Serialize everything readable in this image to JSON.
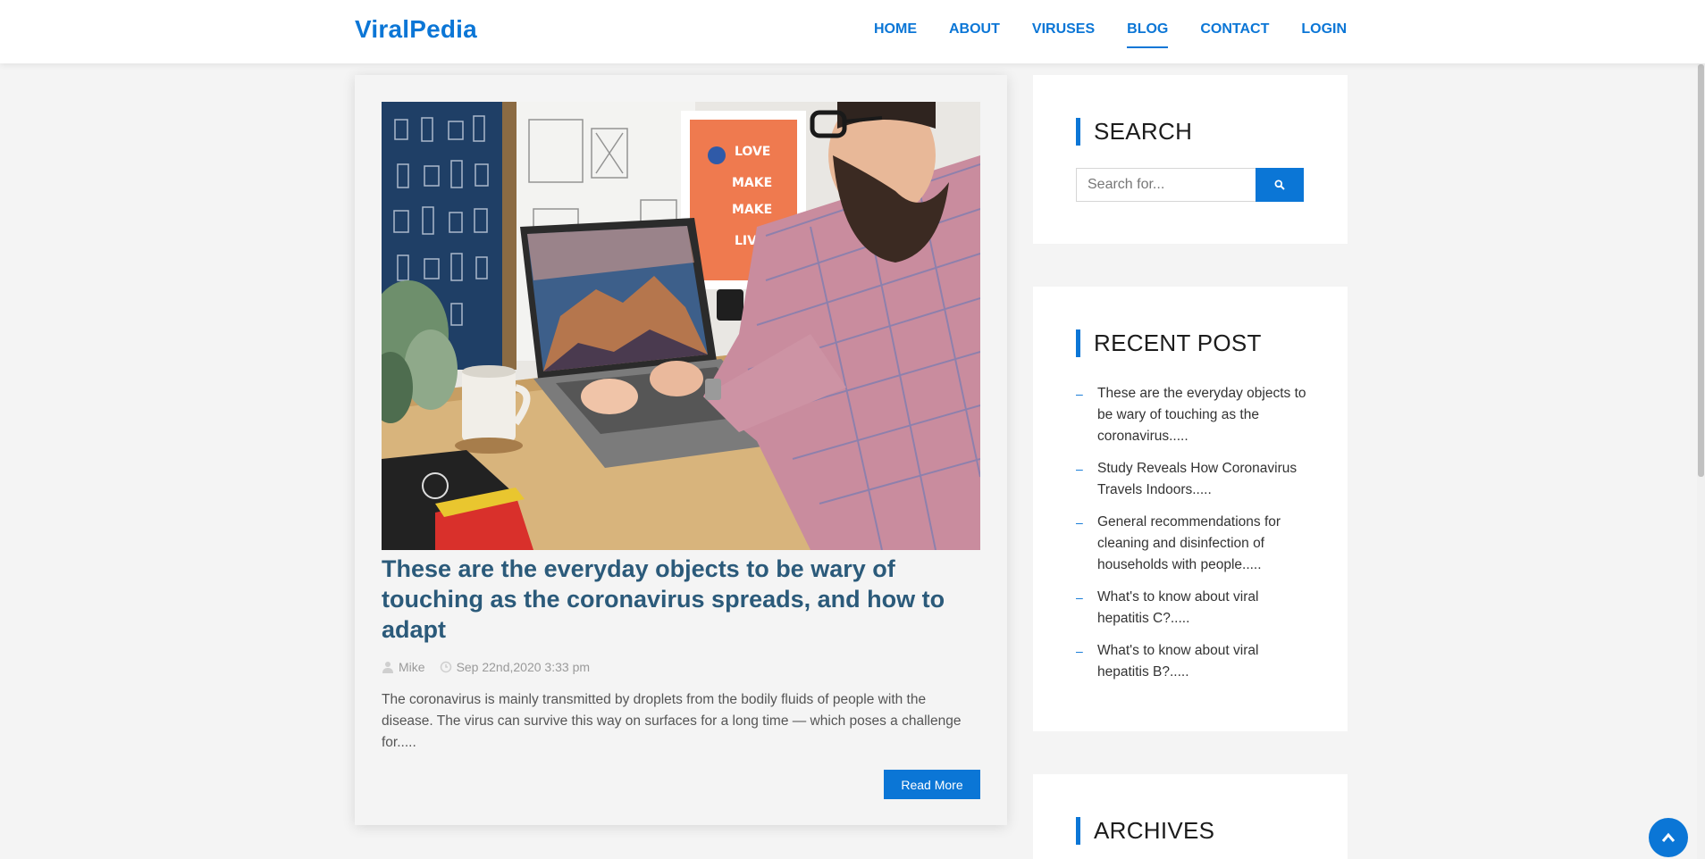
{
  "header": {
    "brand": "ViralPedia",
    "nav": [
      {
        "label": "HOME"
      },
      {
        "label": "ABOUT"
      },
      {
        "label": "VIRUSES"
      },
      {
        "label": "BLOG",
        "active": true
      },
      {
        "label": "CONTACT"
      },
      {
        "label": "LOGIN"
      }
    ]
  },
  "post": {
    "title": "These are the everyday objects to be wary of touching as the coronavirus spreads, and how to adapt",
    "author": "Mike",
    "date": "Sep 22nd,2020 3:33 pm",
    "excerpt": "The coronavirus is mainly transmitted by droplets from the bodily fluids of people with the disease. The virus can survive this way on surfaces for a long time — which poses a challenge for.....",
    "read_more": "Read More"
  },
  "sidebar": {
    "search": {
      "title": "SEARCH",
      "placeholder": "Search for..."
    },
    "recent": {
      "title": "RECENT POST",
      "items": [
        "These are the everyday objects to be wary of touching as the coronavirus.....",
        "Study Reveals How Coronavirus Travels Indoors.....",
        "General recommendations for cleaning and disinfection of households with people.....",
        "What's to know about viral hepatitis C?.....",
        "What's to know about viral hepatitis B?....."
      ]
    },
    "archives": {
      "title": "ARCHIVES"
    }
  },
  "colors": {
    "accent": "#0b76d6",
    "title": "#2b5a7a",
    "background": "#f4f4f4"
  },
  "icons": {
    "author": "user-icon",
    "date": "clock-icon",
    "search": "search-icon",
    "to_top": "chevron-up-icon"
  }
}
